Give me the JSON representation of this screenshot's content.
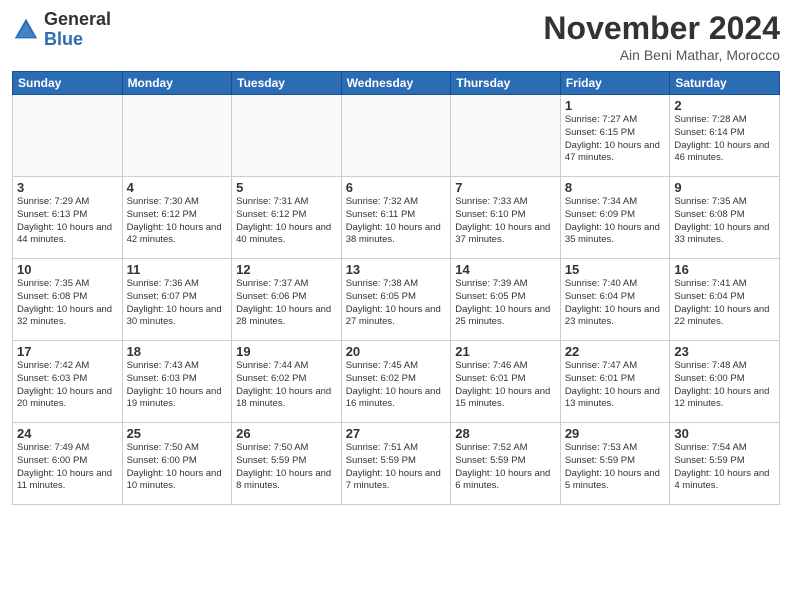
{
  "logo": {
    "general": "General",
    "blue": "Blue"
  },
  "title": "November 2024",
  "location": "Ain Beni Mathar, Morocco",
  "days_of_week": [
    "Sunday",
    "Monday",
    "Tuesday",
    "Wednesday",
    "Thursday",
    "Friday",
    "Saturday"
  ],
  "weeks": [
    [
      {
        "day": "",
        "info": ""
      },
      {
        "day": "",
        "info": ""
      },
      {
        "day": "",
        "info": ""
      },
      {
        "day": "",
        "info": ""
      },
      {
        "day": "",
        "info": ""
      },
      {
        "day": "1",
        "info": "Sunrise: 7:27 AM\nSunset: 6:15 PM\nDaylight: 10 hours and 47 minutes."
      },
      {
        "day": "2",
        "info": "Sunrise: 7:28 AM\nSunset: 6:14 PM\nDaylight: 10 hours and 46 minutes."
      }
    ],
    [
      {
        "day": "3",
        "info": "Sunrise: 7:29 AM\nSunset: 6:13 PM\nDaylight: 10 hours and 44 minutes."
      },
      {
        "day": "4",
        "info": "Sunrise: 7:30 AM\nSunset: 6:12 PM\nDaylight: 10 hours and 42 minutes."
      },
      {
        "day": "5",
        "info": "Sunrise: 7:31 AM\nSunset: 6:12 PM\nDaylight: 10 hours and 40 minutes."
      },
      {
        "day": "6",
        "info": "Sunrise: 7:32 AM\nSunset: 6:11 PM\nDaylight: 10 hours and 38 minutes."
      },
      {
        "day": "7",
        "info": "Sunrise: 7:33 AM\nSunset: 6:10 PM\nDaylight: 10 hours and 37 minutes."
      },
      {
        "day": "8",
        "info": "Sunrise: 7:34 AM\nSunset: 6:09 PM\nDaylight: 10 hours and 35 minutes."
      },
      {
        "day": "9",
        "info": "Sunrise: 7:35 AM\nSunset: 6:08 PM\nDaylight: 10 hours and 33 minutes."
      }
    ],
    [
      {
        "day": "10",
        "info": "Sunrise: 7:35 AM\nSunset: 6:08 PM\nDaylight: 10 hours and 32 minutes."
      },
      {
        "day": "11",
        "info": "Sunrise: 7:36 AM\nSunset: 6:07 PM\nDaylight: 10 hours and 30 minutes."
      },
      {
        "day": "12",
        "info": "Sunrise: 7:37 AM\nSunset: 6:06 PM\nDaylight: 10 hours and 28 minutes."
      },
      {
        "day": "13",
        "info": "Sunrise: 7:38 AM\nSunset: 6:05 PM\nDaylight: 10 hours and 27 minutes."
      },
      {
        "day": "14",
        "info": "Sunrise: 7:39 AM\nSunset: 6:05 PM\nDaylight: 10 hours and 25 minutes."
      },
      {
        "day": "15",
        "info": "Sunrise: 7:40 AM\nSunset: 6:04 PM\nDaylight: 10 hours and 23 minutes."
      },
      {
        "day": "16",
        "info": "Sunrise: 7:41 AM\nSunset: 6:04 PM\nDaylight: 10 hours and 22 minutes."
      }
    ],
    [
      {
        "day": "17",
        "info": "Sunrise: 7:42 AM\nSunset: 6:03 PM\nDaylight: 10 hours and 20 minutes."
      },
      {
        "day": "18",
        "info": "Sunrise: 7:43 AM\nSunset: 6:03 PM\nDaylight: 10 hours and 19 minutes."
      },
      {
        "day": "19",
        "info": "Sunrise: 7:44 AM\nSunset: 6:02 PM\nDaylight: 10 hours and 18 minutes."
      },
      {
        "day": "20",
        "info": "Sunrise: 7:45 AM\nSunset: 6:02 PM\nDaylight: 10 hours and 16 minutes."
      },
      {
        "day": "21",
        "info": "Sunrise: 7:46 AM\nSunset: 6:01 PM\nDaylight: 10 hours and 15 minutes."
      },
      {
        "day": "22",
        "info": "Sunrise: 7:47 AM\nSunset: 6:01 PM\nDaylight: 10 hours and 13 minutes."
      },
      {
        "day": "23",
        "info": "Sunrise: 7:48 AM\nSunset: 6:00 PM\nDaylight: 10 hours and 12 minutes."
      }
    ],
    [
      {
        "day": "24",
        "info": "Sunrise: 7:49 AM\nSunset: 6:00 PM\nDaylight: 10 hours and 11 minutes."
      },
      {
        "day": "25",
        "info": "Sunrise: 7:50 AM\nSunset: 6:00 PM\nDaylight: 10 hours and 10 minutes."
      },
      {
        "day": "26",
        "info": "Sunrise: 7:50 AM\nSunset: 5:59 PM\nDaylight: 10 hours and 8 minutes."
      },
      {
        "day": "27",
        "info": "Sunrise: 7:51 AM\nSunset: 5:59 PM\nDaylight: 10 hours and 7 minutes."
      },
      {
        "day": "28",
        "info": "Sunrise: 7:52 AM\nSunset: 5:59 PM\nDaylight: 10 hours and 6 minutes."
      },
      {
        "day": "29",
        "info": "Sunrise: 7:53 AM\nSunset: 5:59 PM\nDaylight: 10 hours and 5 minutes."
      },
      {
        "day": "30",
        "info": "Sunrise: 7:54 AM\nSunset: 5:59 PM\nDaylight: 10 hours and 4 minutes."
      }
    ]
  ]
}
